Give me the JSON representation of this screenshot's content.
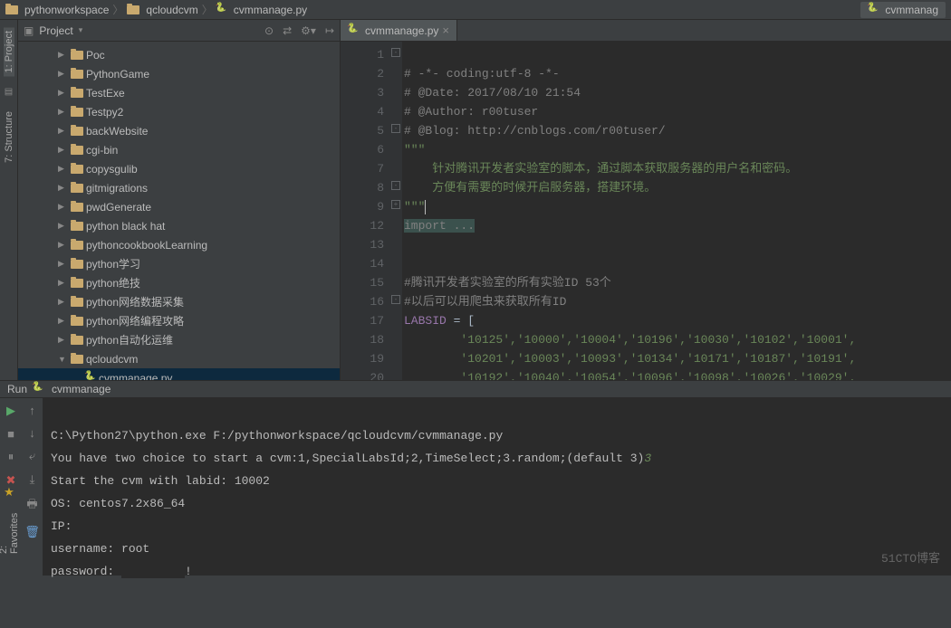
{
  "breadcrumb": {
    "root": "pythonworkspace",
    "mid": "qcloudcvm",
    "file": "cvmmanage.py",
    "right_file": "cvmmanag"
  },
  "rail": {
    "project": "1: Project",
    "structure": "7: Structure",
    "favorites": "2: Favorites"
  },
  "project_panel": {
    "title": "Project",
    "items": [
      {
        "name": "Poc",
        "depth": 1,
        "expand": "▶"
      },
      {
        "name": "PythonGame",
        "depth": 1,
        "expand": "▶"
      },
      {
        "name": "TestExe",
        "depth": 1,
        "expand": "▶"
      },
      {
        "name": "Testpy2",
        "depth": 1,
        "expand": "▶"
      },
      {
        "name": "backWebsite",
        "depth": 1,
        "expand": "▶"
      },
      {
        "name": "cgi-bin",
        "depth": 1,
        "expand": "▶"
      },
      {
        "name": "copysgulib",
        "depth": 1,
        "expand": "▶"
      },
      {
        "name": "gitmigrations",
        "depth": 1,
        "expand": "▶"
      },
      {
        "name": "pwdGenerate",
        "depth": 1,
        "expand": "▶"
      },
      {
        "name": "python black hat",
        "depth": 1,
        "expand": "▶"
      },
      {
        "name": "pythoncookbookLearning",
        "depth": 1,
        "expand": "▶"
      },
      {
        "name": "python学习",
        "depth": 1,
        "expand": "▶"
      },
      {
        "name": "python绝技",
        "depth": 1,
        "expand": "▶"
      },
      {
        "name": "python网络数据采集",
        "depth": 1,
        "expand": "▶"
      },
      {
        "name": "python网络编程攻略",
        "depth": 1,
        "expand": "▶"
      },
      {
        "name": "python自动化运维",
        "depth": 1,
        "expand": "▶"
      },
      {
        "name": "qcloudcvm",
        "depth": 1,
        "expand": "▼"
      },
      {
        "name": "cvmmanage.py",
        "depth": 2,
        "expand": "",
        "file": true,
        "sel": true
      }
    ]
  },
  "editor": {
    "tab": "cvmmanage.py",
    "lines": [
      "1",
      "2",
      "3",
      "4",
      "5",
      "6",
      "7",
      "8",
      "9",
      "12",
      "13",
      "14",
      "15",
      "16",
      "17",
      "18",
      "19",
      "20"
    ],
    "code": {
      "l1": "# -*- coding:utf-8 -*-",
      "l2": "# @Date: 2017/08/10 21:54",
      "l3": "# @Author: r00tuser",
      "l4": "# @Blog: http://cnblogs.com/r00tuser/",
      "l5": "\"\"\"",
      "l6": "    针对腾讯开发者实验室的脚本，通过脚本获取服务器的用户名和密码。",
      "l7": "    方便有需要的时候开启服务器，搭建环境。",
      "l8": "\"\"\"",
      "l9": "import ...",
      "l14": "#腾讯开发者实验室的所有实验ID 53个",
      "l15": "#以后可以用爬虫来获取所有ID",
      "l16_a": "LABSID",
      "l16_b": " = [",
      "l17": "        '10125','10000','10004','10196','10030','10102','10001',",
      "l18": "        '10201','10003','10093','10134','10171','10187','10191',",
      "l19": "        '10192','10040','10054','10096','10098','10026','10029',"
    }
  },
  "run": {
    "label": "Run",
    "name": "cvmmanage",
    "lines": {
      "l1": "C:\\Python27\\python.exe F:/pythonworkspace/qcloudcvm/cvmmanage.py",
      "l2a": "You have two choice to start a cvm:1,SpecialLabsId;2,TimeSelect;3.random;(default 3)",
      "l2b": "3",
      "l3": "Start the cvm with labid: 10002",
      "l4": "OS: centos7.2x86_64",
      "l5": "IP: ",
      "l6": "username: root",
      "l7": "password: ",
      "l7b": "!"
    }
  },
  "watermark": "51CTO博客"
}
